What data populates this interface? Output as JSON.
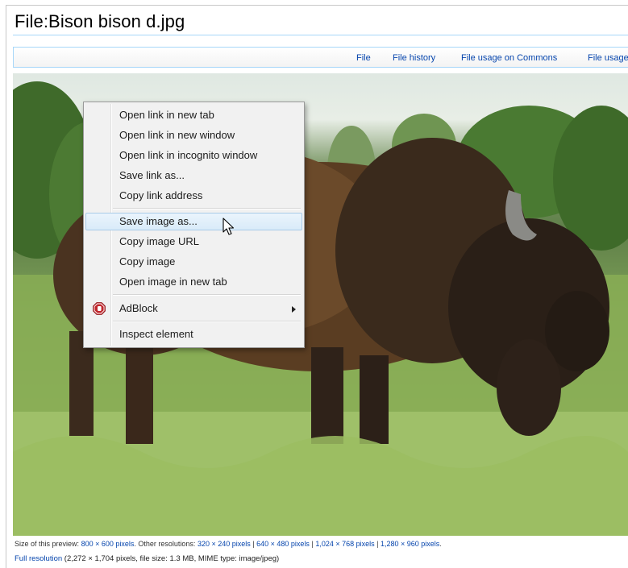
{
  "page": {
    "title": "File:Bison bison d.jpg"
  },
  "tabs": [
    {
      "label": "File"
    },
    {
      "label": "File history"
    },
    {
      "label": "File usage on Commons"
    },
    {
      "label": "File usage"
    }
  ],
  "context_menu": {
    "items": [
      {
        "label": "Open link in new tab"
      },
      {
        "label": "Open link in new window"
      },
      {
        "label": "Open link in incognito window"
      },
      {
        "label": "Save link as..."
      },
      {
        "label": "Copy link address"
      },
      {
        "label": "Save image as..."
      },
      {
        "label": "Copy image URL"
      },
      {
        "label": "Copy image"
      },
      {
        "label": "Open image in new tab"
      },
      {
        "label": "AdBlock"
      },
      {
        "label": "Inspect element"
      }
    ],
    "highlighted": "Save image as...",
    "adblock_icon": "adblock-stop-hand-icon",
    "submenu_icon": "chevron-right-icon"
  },
  "caption": {
    "prefix": "Size of this preview:",
    "preview_link": "800 × 600 pixels",
    "middle": ". Other resolutions:",
    "res_320": "320 × 240 pixels",
    "res_640": "640 × 480 pixels",
    "res_1024": "1,024 × 768 pixels",
    "res_1280": "1,280 × 960 pixels",
    "sep": "|",
    "end": "."
  },
  "fullres": {
    "link": "Full resolution",
    "details": "(2,272 × 1,704 pixels, file size: 1.3 MB, MIME type: image/jpeg)"
  },
  "colors": {
    "link": "#0645ad",
    "tab_border": "#a7d7f9",
    "menu_bg": "#f1f1f1",
    "menu_highlight": "#d9ebf9",
    "adblock_red": "#c0272d"
  }
}
